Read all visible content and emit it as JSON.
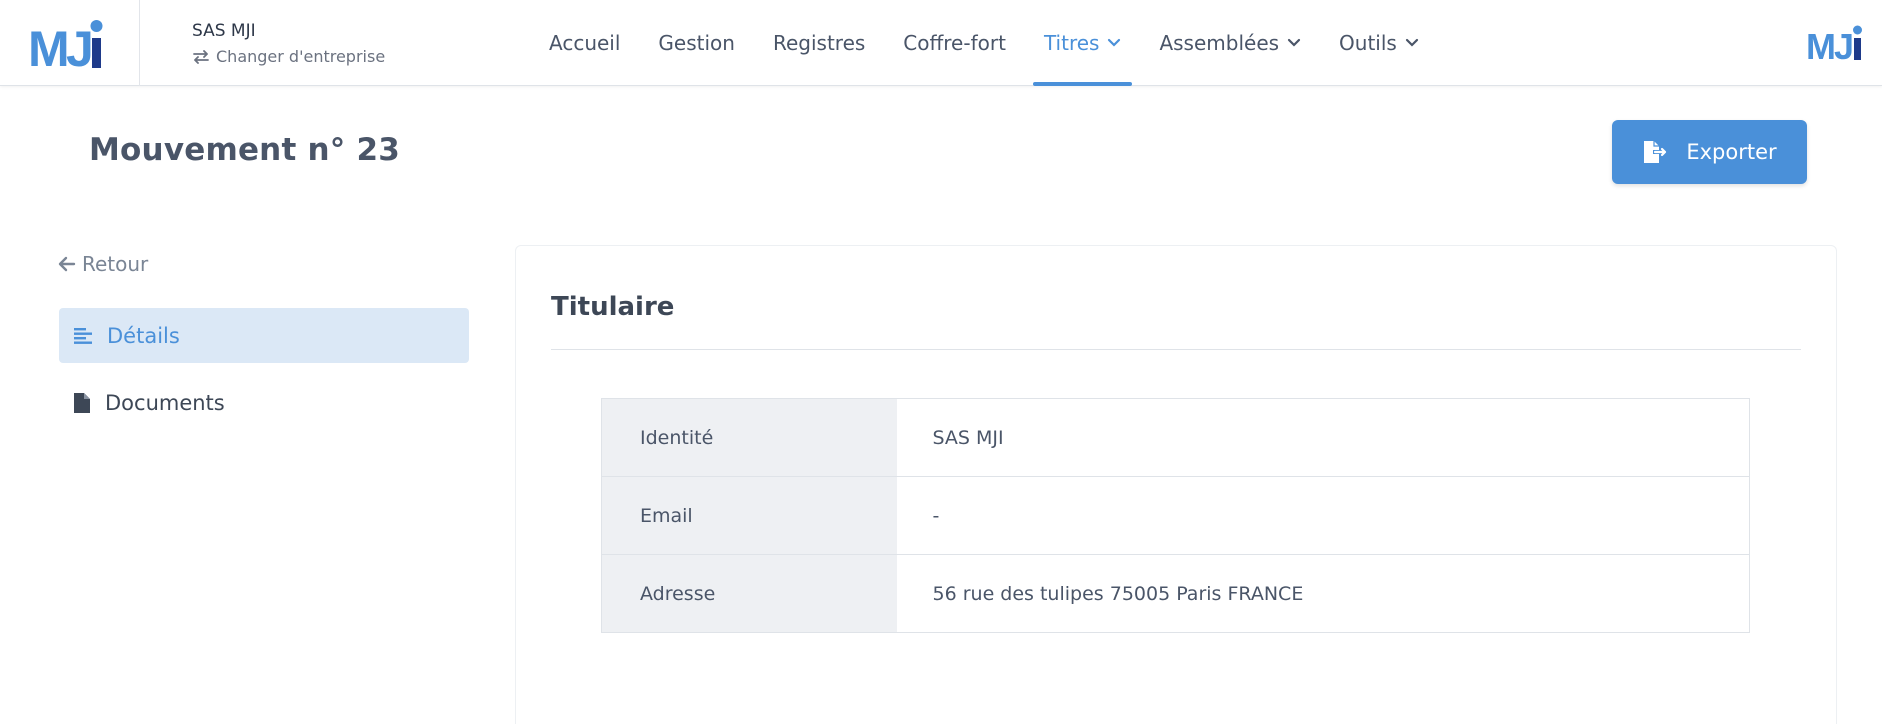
{
  "brand": {
    "logo_text": "MJI",
    "accent": "#4a90d9",
    "dark": "#1e3a8a"
  },
  "company": {
    "name": "SAS MJI",
    "switch_label": "Changer d'entreprise",
    "switch_icon": "swap-arrows-icon"
  },
  "nav": {
    "items": [
      {
        "label": "Accueil"
      },
      {
        "label": "Gestion"
      },
      {
        "label": "Registres"
      },
      {
        "label": "Coffre-fort"
      },
      {
        "label": "Titres",
        "active": true,
        "dropdown": true
      },
      {
        "label": "Assemblées",
        "dropdown": true
      },
      {
        "label": "Outils",
        "dropdown": true
      }
    ]
  },
  "page": {
    "title_prefix": "Mouvement n°",
    "title_number": "23",
    "export_label": "Exporter",
    "export_icon": "file-export-icon"
  },
  "sidebar": {
    "back_label": "Retour",
    "items": [
      {
        "label": "Détails",
        "icon": "align-left-icon",
        "active": true
      },
      {
        "label": "Documents",
        "icon": "file-icon"
      }
    ]
  },
  "card": {
    "title": "Titulaire",
    "rows": [
      {
        "label": "Identité",
        "value": "SAS MJI"
      },
      {
        "label": "Email",
        "value": "-"
      },
      {
        "label": "Adresse",
        "value": "56 rue des tulipes 75005 Paris FRANCE"
      }
    ]
  }
}
